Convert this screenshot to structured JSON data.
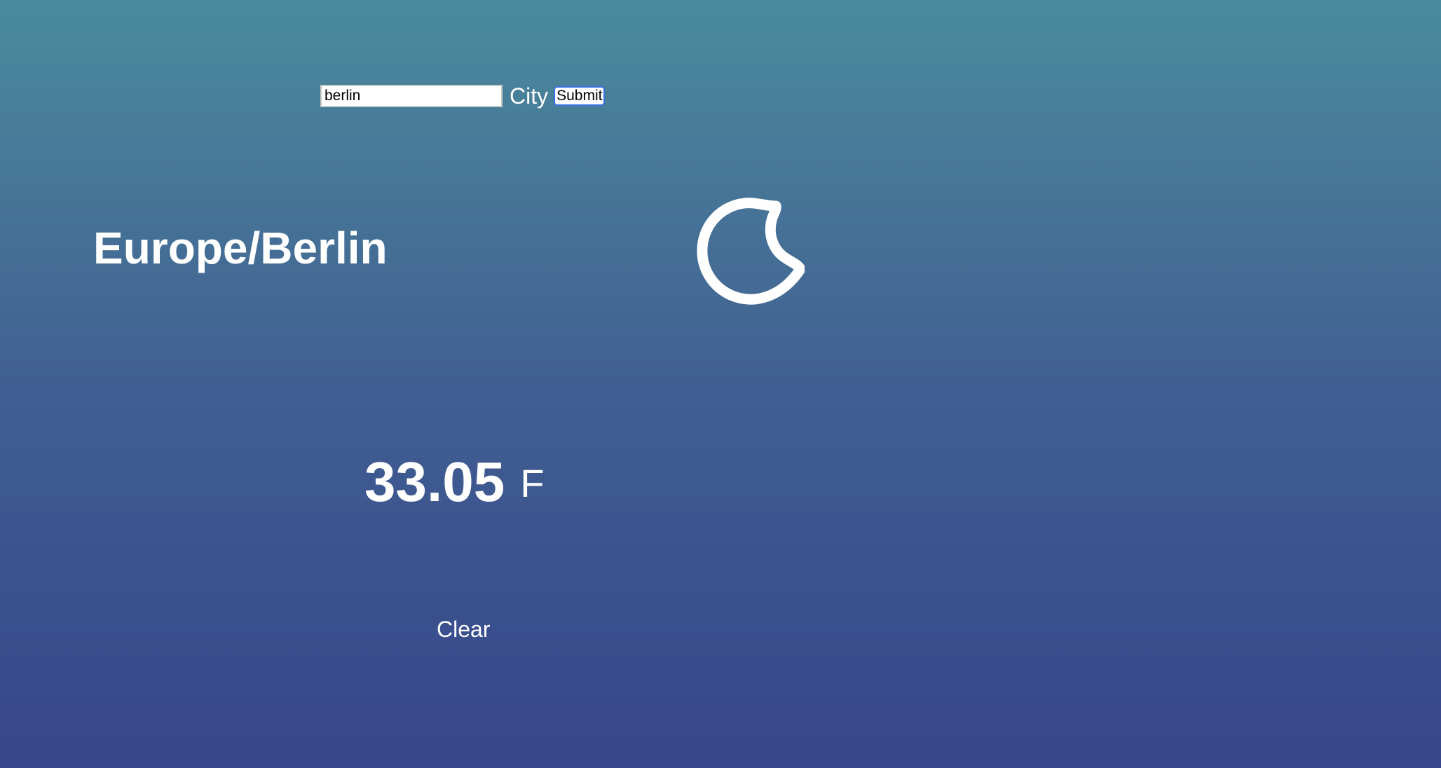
{
  "search": {
    "input_value": "berlin",
    "city_label": "City",
    "submit_label": "Submit"
  },
  "location": {
    "timezone": "Europe/Berlin"
  },
  "weather": {
    "icon": "crescent-moon-icon",
    "temperature": "33.05",
    "unit": "F"
  },
  "actions": {
    "clear_label": "Clear"
  },
  "colors": {
    "background_top": "#4b8b9d",
    "background_bottom": "#36468a",
    "text": "#ffffff",
    "submit_border": "#3b6fe0"
  }
}
